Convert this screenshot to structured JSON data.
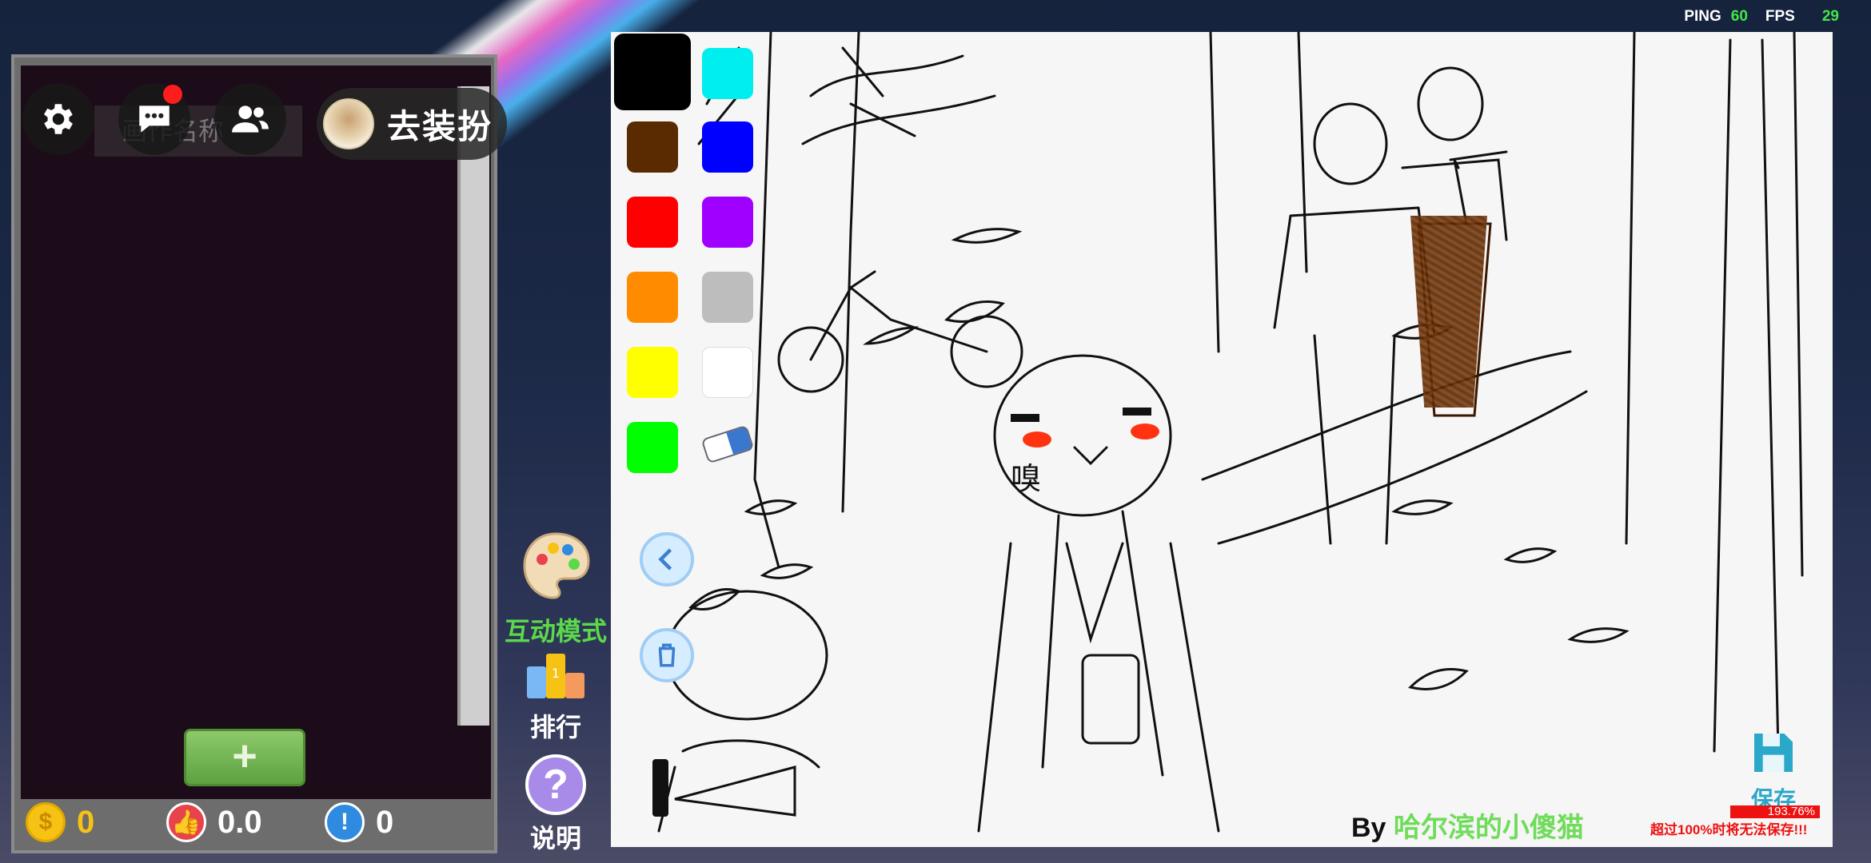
{
  "hud": {
    "ping_label": "PING",
    "ping": "60",
    "fps_label": "FPS",
    "fps": "29"
  },
  "left": {
    "name_placeholder": "画作名称",
    "dressup_label": "去装扮"
  },
  "stats": {
    "coins": "0",
    "likes": "0.0",
    "alerts": "0"
  },
  "tools": {
    "interact": "互动模式",
    "rank": "排行",
    "help": "说明"
  },
  "palette": {
    "selected": "#000000",
    "colors": [
      "#00eeee",
      "#5a2a00",
      "#0000ff",
      "#ff0000",
      "#a000ff",
      "#ff8c00",
      "#bdbdbd",
      "#ffff00",
      "#ffffff",
      "#00ff00"
    ]
  },
  "canvas": {
    "doodle_text": "嗅",
    "signature_prefix": "By ",
    "signature_name": "哈尔滨的小傻猫",
    "save_label": "保存",
    "capacity": "193.76%",
    "warning": "超过100%时将无法保存!!!"
  },
  "colors": {
    "green": "#5bd94b",
    "yellow": "#f6c315",
    "accent": "#5da240"
  }
}
